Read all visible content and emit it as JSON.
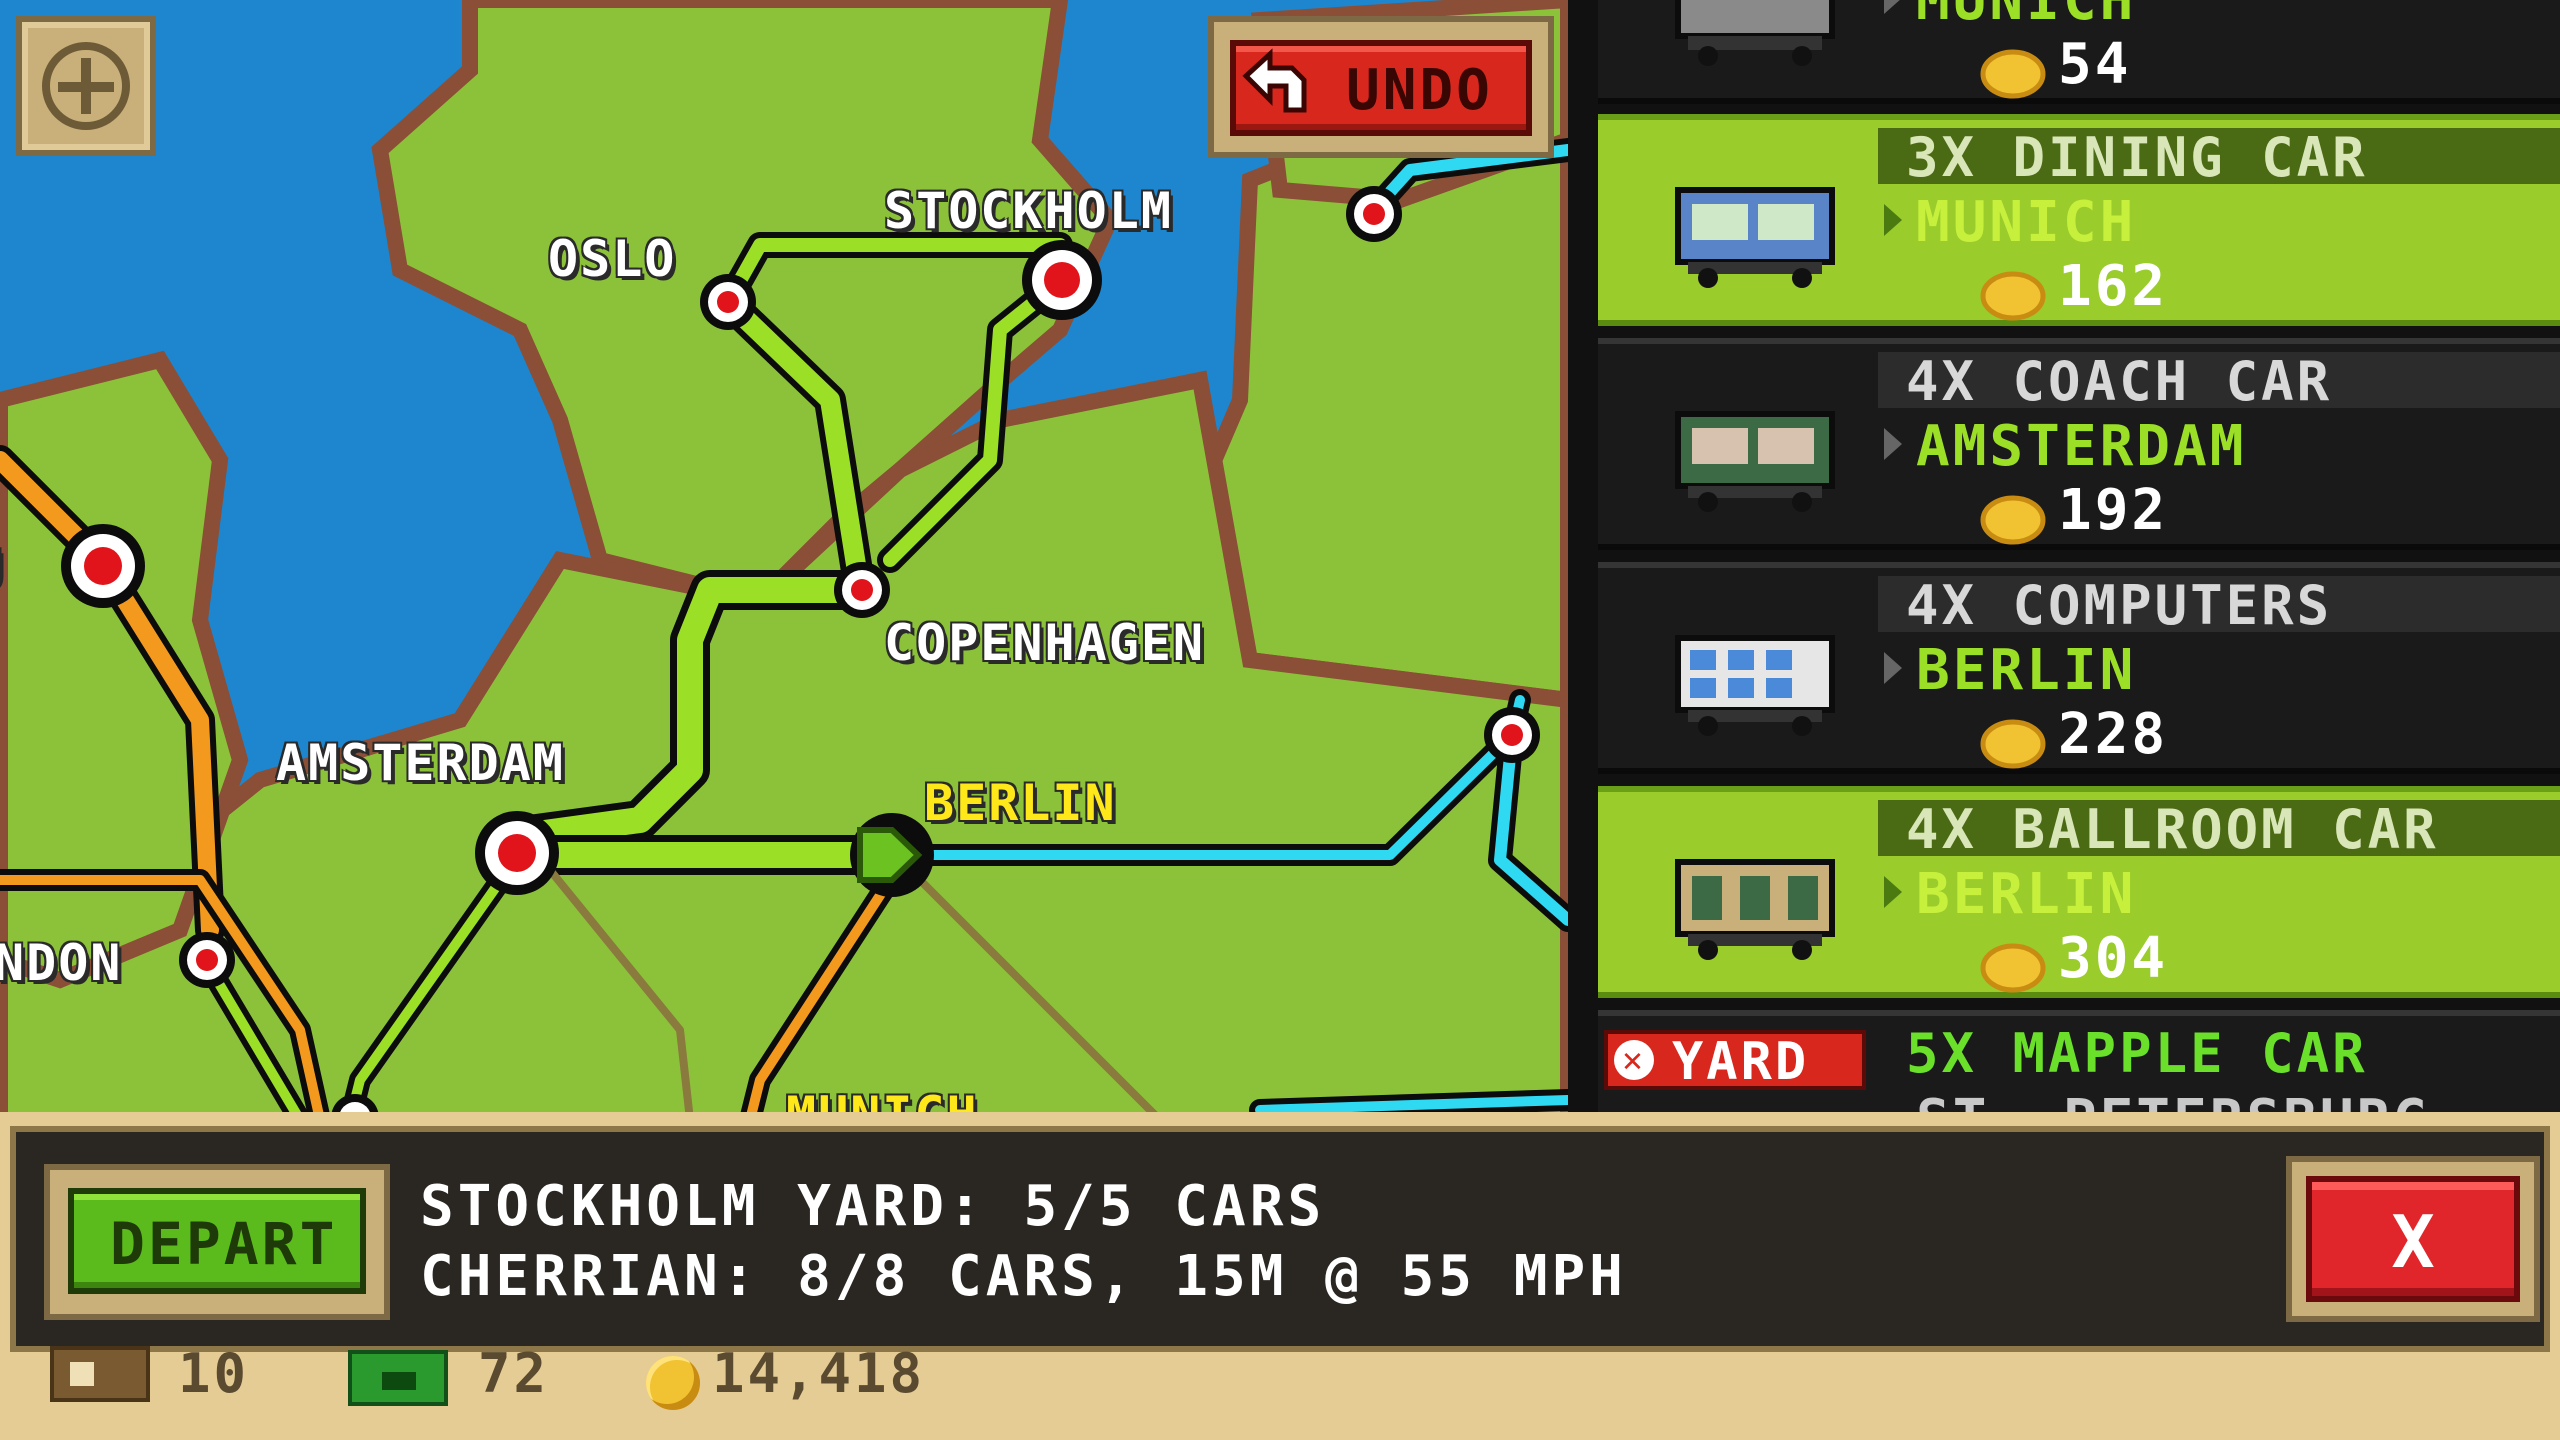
{
  "map": {
    "cities": {
      "oslo": "OSLO",
      "stockholm": "STOCKHOLM",
      "copenhagen": "COPENHAGEN",
      "amsterdam": "AMSTERDAM",
      "berlin": "BERLIN",
      "london_partial": "NDON",
      "munich_partial": "MUNICH",
      "left_edge_partial": "U"
    },
    "undo_label": "UNDO"
  },
  "cargo_list": [
    {
      "title": "",
      "dest": "MUNICH",
      "price": "54",
      "selected": false,
      "partial": true
    },
    {
      "title": "3X DINING CAR",
      "dest": "MUNICH",
      "price": "162",
      "selected": true
    },
    {
      "title": "4X COACH CAR",
      "dest": "AMSTERDAM",
      "price": "192",
      "selected": false
    },
    {
      "title": "4X COMPUTERS",
      "dest": "BERLIN",
      "price": "228",
      "selected": false
    },
    {
      "title": "4X BALLROOM CAR",
      "dest": "BERLIN",
      "price": "304",
      "selected": true
    },
    {
      "title": "5X MAPPLE CAR",
      "dest": "ST. PETERSBURG",
      "price": "",
      "selected": false,
      "partial": true
    }
  ],
  "yard_badge": "YARD",
  "status": {
    "depart_label": "DEPART",
    "line1": "STOCKHOLM YARD: 5/5 CARS",
    "line2": "CHERRIAN: 8/8 CARS, 15M @ 55 MPH",
    "close_label": "X"
  },
  "footer": {
    "crates": "10",
    "bux": "72",
    "coins": "14,418"
  },
  "colors": {
    "sea": "#1d86cf",
    "land": "#8cc23a",
    "route_green": "#9be026",
    "route_orange": "#f39a1e",
    "route_cyan": "#2fd9f2",
    "selected_row": "#9acc2c"
  }
}
